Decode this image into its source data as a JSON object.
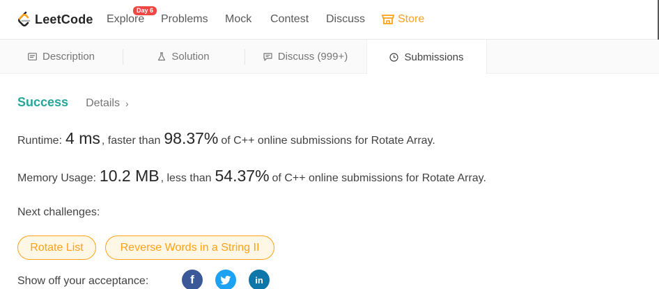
{
  "nav": {
    "logo_text": "LeetCode",
    "explore": "Explore",
    "explore_badge": "Day 6",
    "problems": "Problems",
    "mock": "Mock",
    "contest": "Contest",
    "discuss": "Discuss",
    "store": "Store"
  },
  "tabs": {
    "description": "Description",
    "solution": "Solution",
    "discuss": "Discuss (999+)",
    "submissions": "Submissions",
    "active": "Submissions"
  },
  "result": {
    "status": "Success",
    "details": "Details",
    "runtime_label": "Runtime:",
    "runtime_value": "4 ms",
    "runtime_comparator": ", faster than",
    "runtime_percent": "98.37%",
    "runtime_suffix": "of C++ online submissions for Rotate Array.",
    "memory_label": "Memory Usage:",
    "memory_value": "10.2 MB",
    "memory_comparator": ", less than",
    "memory_percent": "54.37%",
    "memory_suffix": "of C++ online submissions for Rotate Array."
  },
  "next": {
    "label": "Next challenges:",
    "items": [
      "Rotate List",
      "Reverse Words in a String II"
    ]
  },
  "share": {
    "label": "Show off your acceptance:",
    "networks": [
      "facebook-icon",
      "twitter-icon",
      "linkedin-icon"
    ]
  },
  "colors": {
    "accent": "#ffa116",
    "success": "#26a69a",
    "badge": "#ef4743"
  }
}
